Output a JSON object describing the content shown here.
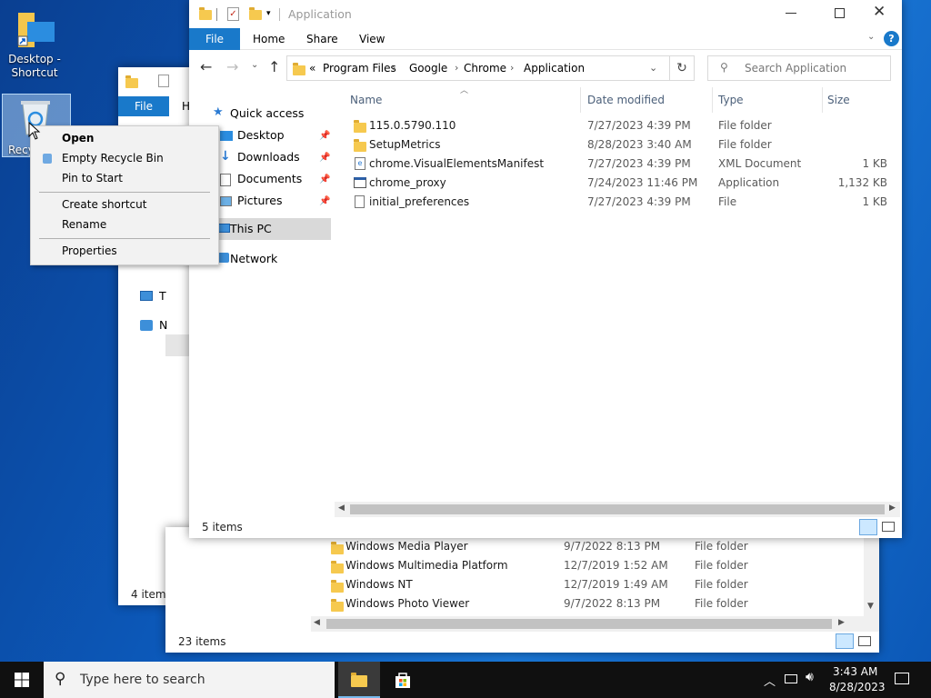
{
  "desktop": {
    "icons": [
      {
        "label": "Desktop - Shortcut"
      },
      {
        "label": "Recy"
      }
    ]
  },
  "back_window_1": {
    "file_tab": "File",
    "home_tab_partial": "H",
    "nav_partial": [
      "T",
      "N"
    ],
    "status": "4 items"
  },
  "back_window_2": {
    "rows": [
      {
        "name": "Windows Media Player",
        "date": "9/7/2022 8:13 PM",
        "type": "File folder"
      },
      {
        "name": "Windows Multimedia Platform",
        "date": "12/7/2019 1:52 AM",
        "type": "File folder"
      },
      {
        "name": "Windows NT",
        "date": "12/7/2019 1:49 AM",
        "type": "File folder"
      },
      {
        "name": "Windows Photo Viewer",
        "date": "9/7/2022 8:13 PM",
        "type": "File folder"
      }
    ],
    "status": "23 items"
  },
  "explorer": {
    "title": "Application",
    "ribbon_tabs": [
      "File",
      "Home",
      "Share",
      "View"
    ],
    "breadcrumb": [
      "«",
      "Program Files",
      "Google",
      "Chrome",
      "Application"
    ],
    "search_placeholder": "Search Application",
    "columns": {
      "name": "Name",
      "date": "Date modified",
      "type": "Type",
      "size": "Size"
    },
    "nav": {
      "quick_access": "Quick access",
      "desktop": "Desktop",
      "downloads": "Downloads",
      "documents": "Documents",
      "pictures": "Pictures",
      "this_pc": "This PC",
      "network": "Network"
    },
    "files": [
      {
        "name": "115.0.5790.110",
        "date": "7/27/2023 4:39 PM",
        "type": "File folder",
        "size": "",
        "icon": "folder-icon"
      },
      {
        "name": "SetupMetrics",
        "date": "8/28/2023 3:40 AM",
        "type": "File folder",
        "size": "",
        "icon": "folder-icon"
      },
      {
        "name": "chrome.VisualElementsManifest",
        "date": "7/27/2023 4:39 PM",
        "type": "XML Document",
        "size": "1 KB",
        "icon": "xml-file-icon"
      },
      {
        "name": "chrome_proxy",
        "date": "7/24/2023 11:46 PM",
        "type": "Application",
        "size": "1,132 KB",
        "icon": "application-icon"
      },
      {
        "name": "initial_preferences",
        "date": "7/27/2023 4:39 PM",
        "type": "File",
        "size": "1 KB",
        "icon": "file-icon"
      }
    ],
    "status": "5 items"
  },
  "context_menu": {
    "items": [
      "Open",
      "Empty Recycle Bin",
      "Pin to Start",
      "Create shortcut",
      "Rename",
      "Properties"
    ]
  },
  "taskbar": {
    "search_placeholder": "Type here to search",
    "time": "3:43 AM",
    "date": "8/28/2023"
  },
  "colors": {
    "accent": "#1979ca",
    "selection": "#cce8ff",
    "taskbar": "#101010"
  }
}
